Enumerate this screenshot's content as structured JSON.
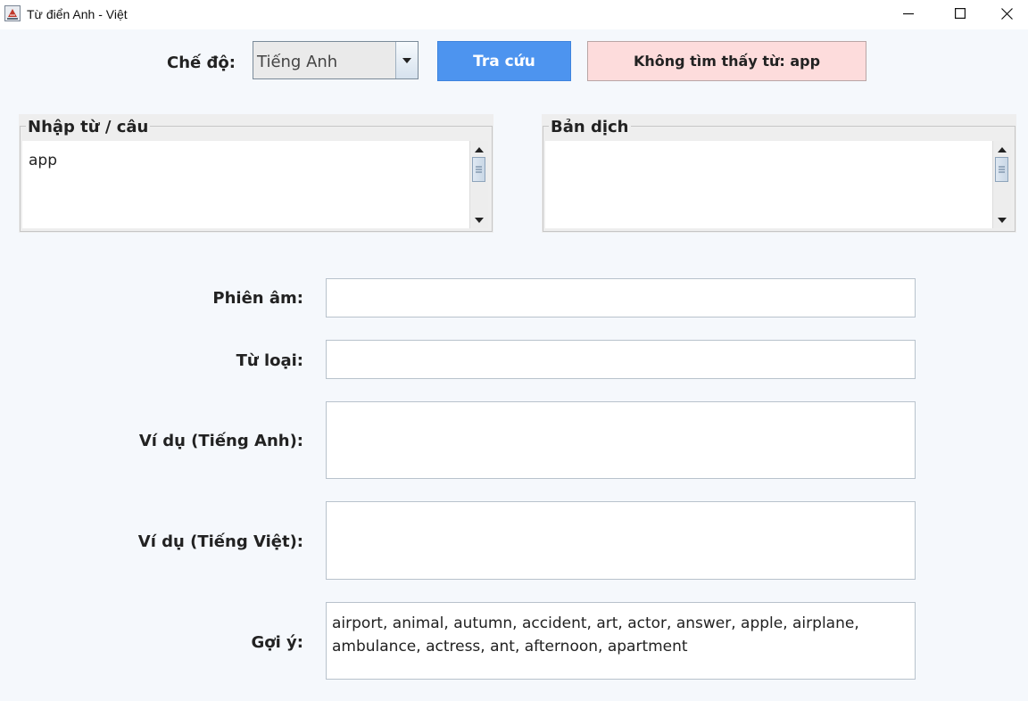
{
  "window": {
    "title": "Từ điển Anh - Việt"
  },
  "toolbar": {
    "mode_label": "Chế độ:",
    "mode_value": "Tiếng Anh",
    "search_label": "Tra cứu",
    "status_message": "Không tìm thấy từ: app",
    "search_color": "#4d94ef",
    "status_bg_color": "#fddcdc"
  },
  "input_panel": {
    "title": "Nhập từ / câu",
    "value": "app"
  },
  "translation_panel": {
    "title": "Bản dịch",
    "value": ""
  },
  "details": {
    "phonetic_label": "Phiên âm:",
    "phonetic_value": "",
    "word_type_label": "Từ loại:",
    "word_type_value": "",
    "example_en_label": "Ví dụ (Tiếng Anh):",
    "example_en_value": "",
    "example_vi_label": "Ví dụ (Tiếng Việt):",
    "example_vi_value": "",
    "suggestions_label": "Gợi ý:",
    "suggestions_line1": "airport, animal, autumn, accident, art, actor, answer, apple, airplane,",
    "suggestions_line2": "ambulance, actress, ant, afternoon, apartment"
  },
  "icons": {
    "app": "java-cup-icon",
    "minimize": "minimize-icon",
    "maximize": "maximize-icon",
    "close": "close-icon",
    "dropdown": "chevron-down-icon"
  }
}
